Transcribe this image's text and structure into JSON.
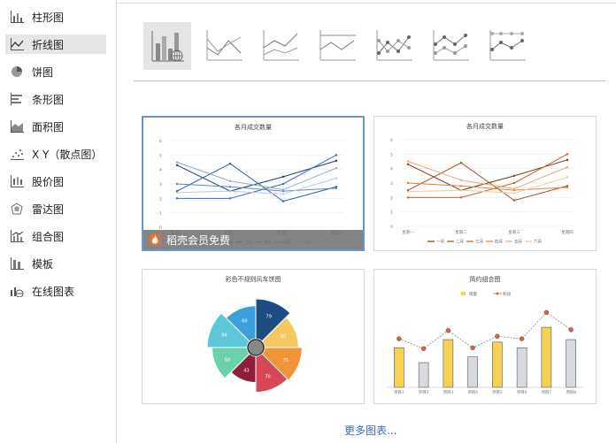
{
  "sidebar": {
    "items": [
      {
        "label": "柱形图",
        "icon": "bar-chart-icon",
        "active": false
      },
      {
        "label": "折线图",
        "icon": "line-chart-icon",
        "active": true
      },
      {
        "label": "饼图",
        "icon": "pie-chart-icon",
        "active": false
      },
      {
        "label": "条形图",
        "icon": "horizontal-bar-icon",
        "active": false
      },
      {
        "label": "面积图",
        "icon": "area-chart-icon",
        "active": false
      },
      {
        "label": "X Y（散点图）",
        "icon": "scatter-icon",
        "active": false
      },
      {
        "label": "股价图",
        "icon": "stock-chart-icon",
        "active": false
      },
      {
        "label": "雷达图",
        "icon": "radar-chart-icon",
        "active": false
      },
      {
        "label": "组合图",
        "icon": "combo-chart-icon",
        "active": false
      },
      {
        "label": "模板",
        "icon": "template-icon",
        "active": false
      },
      {
        "label": "在线图表",
        "icon": "online-chart-icon",
        "active": false
      }
    ]
  },
  "subtypes": [
    {
      "name": "online-line-chart",
      "active": true
    },
    {
      "name": "line",
      "active": false
    },
    {
      "name": "stacked-line",
      "active": false
    },
    {
      "name": "percent-stacked-line",
      "active": false
    },
    {
      "name": "line-with-markers",
      "active": false
    },
    {
      "name": "stacked-line-with-markers",
      "active": false
    },
    {
      "name": "percent-stacked-line-with-markers",
      "active": false
    }
  ],
  "cards": [
    {
      "title": "各月成交数量",
      "selected": true,
      "badge": "稻壳会员免费",
      "categories": [
        "星期一",
        "星期二",
        "星期三",
        "星期四"
      ],
      "yticks": [
        "0",
        "1",
        "2",
        "3",
        "4",
        "5",
        "6"
      ],
      "legend": [
        "一月",
        "二月",
        "三月",
        "四月",
        "五月",
        "六月"
      ],
      "palette": [
        "#1f3f7a",
        "#2a5ca8",
        "#3b6db5",
        "#5f86c0",
        "#8ea9d0",
        "#b7c9e3"
      ],
      "series": [
        [
          4.3,
          2.5,
          3.5,
          4.6
        ],
        [
          2.5,
          4.4,
          1.8,
          2.8
        ],
        [
          2.0,
          2.0,
          3.0,
          5.0
        ],
        [
          3.0,
          2.8,
          2.5,
          2.7
        ],
        [
          4.5,
          3.2,
          2.6,
          4.1
        ],
        [
          2.4,
          2.5,
          2.3,
          3.4
        ]
      ]
    },
    {
      "title": "各月成交数量",
      "selected": false,
      "categories": [
        "星期一",
        "星期二",
        "星期三",
        "星期四"
      ],
      "yticks": [
        "0",
        "1",
        "2",
        "3",
        "4",
        "5",
        "6"
      ],
      "legend": [
        "一月",
        "二月",
        "三月",
        "四月",
        "五月",
        "六月"
      ],
      "palette": [
        "#7a3a12",
        "#a64d16",
        "#c9621c",
        "#dd8140",
        "#e8a673",
        "#f0c6a4"
      ],
      "series": [
        [
          4.3,
          2.5,
          3.5,
          4.6
        ],
        [
          2.5,
          4.4,
          1.8,
          2.8
        ],
        [
          2.0,
          2.0,
          3.0,
          5.0
        ],
        [
          3.0,
          2.8,
          2.5,
          2.7
        ],
        [
          4.5,
          3.2,
          2.6,
          4.1
        ],
        [
          2.4,
          2.5,
          2.3,
          3.4
        ]
      ]
    },
    {
      "title": "彩色不规则风车饼图",
      "selected": false,
      "slices": [
        {
          "label": "79",
          "value": 1,
          "r": 1.0,
          "color": "#1d4c80"
        },
        {
          "label": "61",
          "value": 1,
          "r": 0.88,
          "color": "#f6c85f"
        },
        {
          "label": "75",
          "value": 1,
          "r": 0.95,
          "color": "#f0943a"
        },
        {
          "label": "70",
          "value": 1,
          "r": 0.92,
          "color": "#d94656"
        },
        {
          "label": "43",
          "value": 1,
          "r": 0.72,
          "color": "#8e1f3a"
        },
        {
          "label": "68",
          "value": 1,
          "r": 0.9,
          "color": "#6bd1a8"
        },
        {
          "label": "84",
          "value": 1,
          "r": 1.0,
          "color": "#5bc7d8"
        },
        {
          "label": "60",
          "value": 1,
          "r": 0.86,
          "color": "#3aa0dc"
        }
      ]
    },
    {
      "title": "简约组合图",
      "selected": false,
      "legend": [
        "销量",
        "利润"
      ],
      "categories": [
        "项目1",
        "项目2",
        "项目3",
        "项目4",
        "项目5",
        "项目6",
        "项目7",
        "项目8"
      ],
      "bars": [
        48,
        30,
        58,
        37,
        55,
        48,
        73,
        58
      ],
      "bar_colors": [
        "#f7d154",
        "#d7dbe0",
        "#f7d154",
        "#d7dbe0",
        "#f7d154",
        "#d7dbe0",
        "#f7d154",
        "#d7dbe0"
      ],
      "line": [
        59,
        47,
        69,
        48,
        62,
        59,
        91,
        70
      ],
      "line_color": "#c9684a"
    }
  ],
  "more_link": "更多图表..."
}
